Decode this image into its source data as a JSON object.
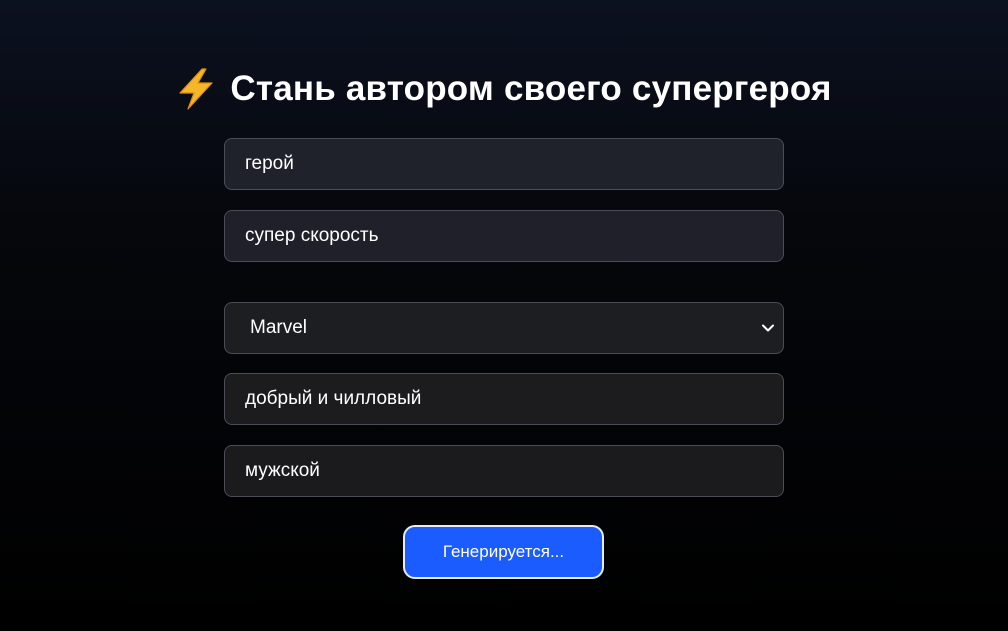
{
  "header": {
    "title": "Стань автором своего супергероя",
    "icon": "lightning-icon"
  },
  "form": {
    "hero_name": {
      "value": "герой"
    },
    "superpower": {
      "value": "супер скорость"
    },
    "universe": {
      "selected": "Marvel"
    },
    "character": {
      "value": "добрый и чилловый"
    },
    "gender": {
      "value": "мужской"
    },
    "submit_label": "Генерируется..."
  },
  "colors": {
    "accent": "#1b5cff",
    "bolt": "#f5b62a",
    "field_border": "#4a4d56"
  }
}
